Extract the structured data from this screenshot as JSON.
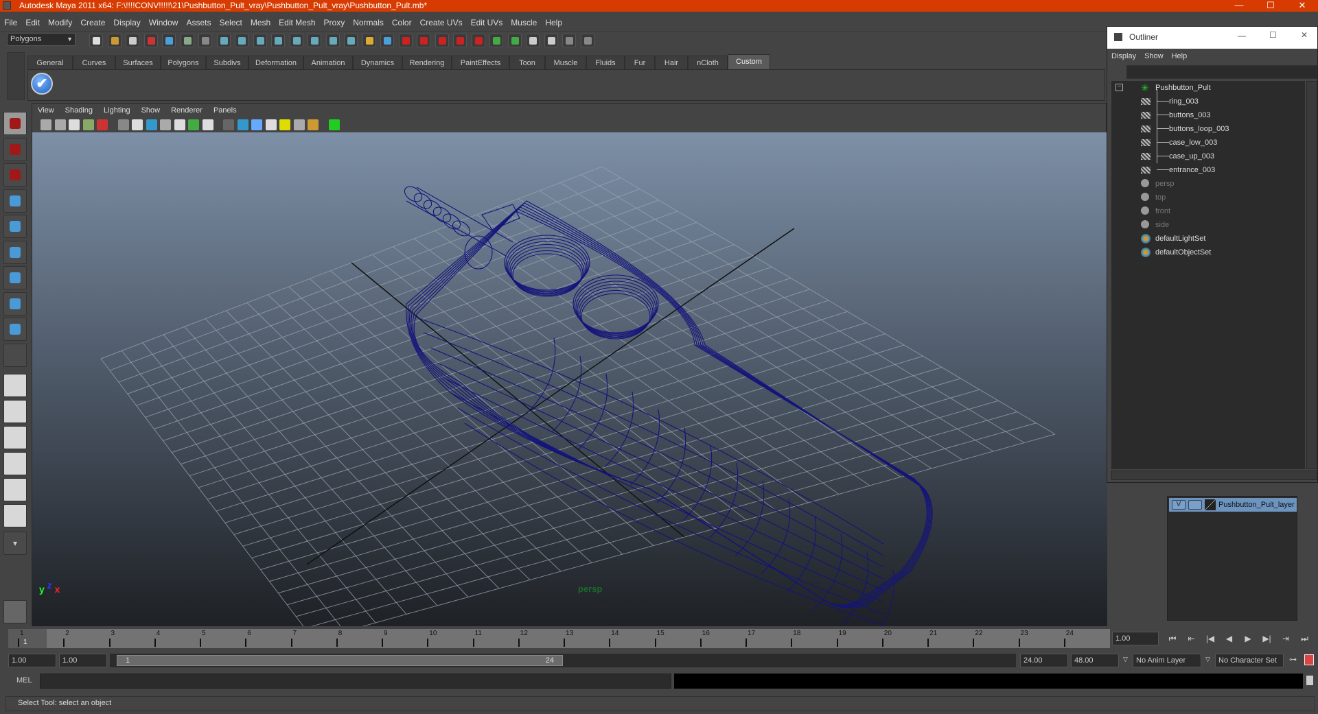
{
  "window": {
    "title": "Autodesk Maya 2011 x64: F:\\!!!!CONV!!!!!\\21\\Pushbutton_Pult_vray\\Pushbutton_Pult_vray\\Pushbutton_Pult.mb*",
    "minimize": "—",
    "maximize": "☐",
    "close": "✕"
  },
  "menubar": [
    "File",
    "Edit",
    "Modify",
    "Create",
    "Display",
    "Window",
    "Assets",
    "Select",
    "Mesh",
    "Edit Mesh",
    "Proxy",
    "Normals",
    "Color",
    "Create UVs",
    "Edit UVs",
    "Muscle",
    "Help"
  ],
  "statusline": {
    "menu_set": "Polygons"
  },
  "shelf": {
    "tabs": [
      "General",
      "Curves",
      "Surfaces",
      "Polygons",
      "Subdivs",
      "Deformation",
      "Animation",
      "Dynamics",
      "Rendering",
      "PaintEffects",
      "Toon",
      "Muscle",
      "Fluids",
      "Fur",
      "Hair",
      "nCloth",
      "Custom"
    ],
    "active_tab": "Custom",
    "check_glyph": "✔"
  },
  "toolbox": {
    "tools": [
      "select-tool",
      "lasso-tool",
      "paint-select-tool",
      "move-tool",
      "rotate-tool",
      "scale-tool",
      "universal-manipulator",
      "soft-modification-tool",
      "show-manipulator-tool",
      "last-tool"
    ],
    "layouts": [
      "single-perspective",
      "four-view",
      "outliner-persp",
      "persp-graph",
      "hypershade-persp",
      "persp-outliner-graph"
    ],
    "more_glyph": "▾"
  },
  "viewport": {
    "menu": [
      "View",
      "Shading",
      "Lighting",
      "Show",
      "Renderer",
      "Panels"
    ],
    "camera_label": "persp",
    "axis_labels": {
      "y": "y",
      "z": "z",
      "x": "x"
    },
    "wire_color": "#14147a",
    "grid_color": "#9aa3b0"
  },
  "timeline": {
    "ticks": [
      "1",
      "2",
      "3",
      "4",
      "5",
      "6",
      "7",
      "8",
      "9",
      "10",
      "11",
      "12",
      "13",
      "14",
      "15",
      "16",
      "17",
      "18",
      "19",
      "20",
      "21",
      "22",
      "23",
      "24"
    ],
    "current_frame_marker": "1",
    "current_time": "1.00",
    "playback_buttons": [
      "⏮",
      "⇤",
      "|◀",
      "◀",
      "▶",
      "▶|",
      "⇥",
      "⏭"
    ]
  },
  "range": {
    "start_time": "1.00",
    "playback_start": "1.00",
    "range_start_label": "1",
    "range_end_label": "24",
    "playback_end": "24.00",
    "end_time": "48.00",
    "anim_layer": "No Anim Layer",
    "character_set": "No Character Set"
  },
  "command_line": {
    "label": "MEL",
    "value": ""
  },
  "help_line": "Select Tool: select an object",
  "outliner": {
    "title": "Outliner",
    "menu": [
      "Display",
      "Show",
      "Help"
    ],
    "items": [
      {
        "name": "Pushbutton_Pult",
        "type": "group",
        "level": 0
      },
      {
        "name": "ring_003",
        "type": "mesh",
        "level": 1
      },
      {
        "name": "buttons_003",
        "type": "mesh",
        "level": 1
      },
      {
        "name": "buttons_loop_003",
        "type": "mesh",
        "level": 1
      },
      {
        "name": "case_low_003",
        "type": "mesh",
        "level": 1
      },
      {
        "name": "case_up_003",
        "type": "mesh",
        "level": 1
      },
      {
        "name": "entrance_003",
        "type": "mesh",
        "level": 1
      },
      {
        "name": "persp",
        "type": "camera",
        "level": 0
      },
      {
        "name": "top",
        "type": "camera",
        "level": 0
      },
      {
        "name": "front",
        "type": "camera",
        "level": 0
      },
      {
        "name": "side",
        "type": "camera",
        "level": 0
      },
      {
        "name": "defaultLightSet",
        "type": "set",
        "level": 0
      },
      {
        "name": "defaultObjectSet",
        "type": "set",
        "level": 0
      }
    ]
  },
  "layer_editor": {
    "layers": [
      {
        "name": "Pushbutton_Pult_layer",
        "visible": "V"
      }
    ]
  }
}
